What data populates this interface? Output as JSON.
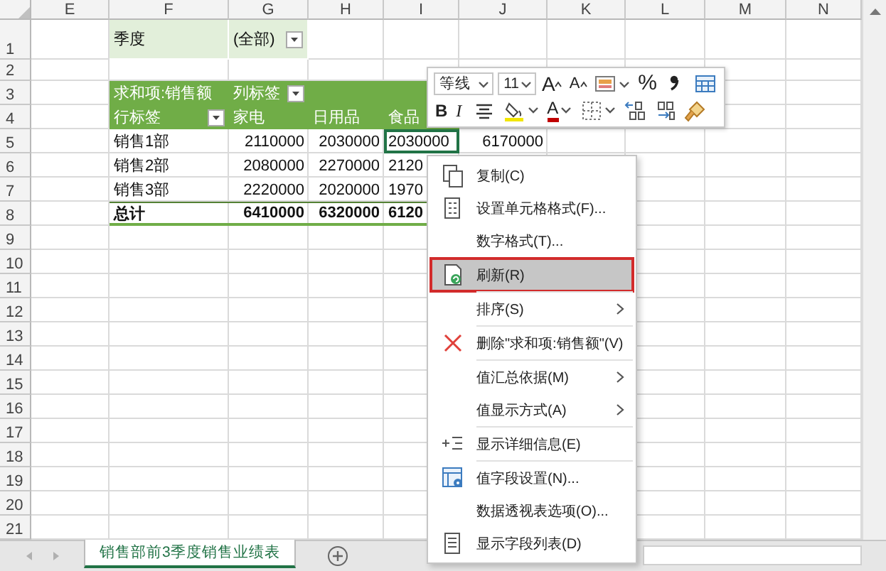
{
  "sheet": {
    "columns": [
      "E",
      "F",
      "G",
      "H",
      "I",
      "J",
      "K",
      "L",
      "M",
      "N"
    ],
    "rows": [
      "1",
      "2",
      "3",
      "4",
      "5",
      "6",
      "7",
      "8",
      "9",
      "10",
      "11",
      "12",
      "13",
      "14",
      "15",
      "16",
      "17",
      "18",
      "19",
      "20",
      "21"
    ]
  },
  "pivot": {
    "filter": {
      "label": "季度",
      "value": "(全部)"
    },
    "value_field": "求和项:销售额",
    "column_label": "列标签",
    "row_label": "行标签",
    "categories": [
      "家电",
      "日用品",
      "食品"
    ],
    "rows": [
      {
        "name": "销售1部",
        "values": [
          {
            "text": "2110000",
            "selected": false
          },
          {
            "text": "2030000",
            "selected": false
          },
          {
            "text": "2030000",
            "selected": true
          },
          {
            "text": "6170000",
            "selected": false
          }
        ]
      },
      {
        "name": "销售2部",
        "values": [
          {
            "text": "2080000",
            "selected": false
          },
          {
            "text": "2270000",
            "selected": false
          },
          {
            "text": "2120",
            "selected": false
          }
        ]
      },
      {
        "name": "销售3部",
        "values": [
          {
            "text": "2220000",
            "selected": false
          },
          {
            "text": "2020000",
            "selected": false
          },
          {
            "text": "1970",
            "selected": false
          }
        ]
      }
    ],
    "total": {
      "name": "总计",
      "values": [
        {
          "text": "6410000",
          "selected": false
        },
        {
          "text": "6320000",
          "selected": false
        },
        {
          "text": "6120",
          "selected": false
        }
      ]
    }
  },
  "mini_toolbar": {
    "font": "等线",
    "size": "11",
    "top_row": [
      {
        "kind": "grow-font",
        "label": "A",
        "dropdown": false
      },
      {
        "kind": "shrink-font",
        "label": "A",
        "dropdown": false
      },
      {
        "kind": "cell-style",
        "dropdown": true
      },
      {
        "kind": "percent",
        "label": "%",
        "dropdown": false
      },
      {
        "kind": "comma",
        "dropdown": false
      },
      {
        "kind": "table-format",
        "dropdown": false
      }
    ],
    "bottom_row": [
      {
        "kind": "bold",
        "label": "B",
        "dropdown": false
      },
      {
        "kind": "italic",
        "label": "I",
        "dropdown": false
      },
      {
        "kind": "align",
        "dropdown": false
      },
      {
        "kind": "fill-color",
        "dropdown": true
      },
      {
        "kind": "font-color",
        "label": "A",
        "dropdown": true
      },
      {
        "kind": "borders",
        "dropdown": true
      },
      {
        "kind": "increase-decimal",
        "dropdown": false
      },
      {
        "kind": "decrease-decimal",
        "dropdown": false
      },
      {
        "kind": "format-painter",
        "dropdown": false
      }
    ]
  },
  "context_menu": {
    "groups": [
      [
        {
          "label": "复制(C)",
          "kind": "copy",
          "submenu": false,
          "selected": false
        },
        {
          "label": "设置单元格格式(F)...",
          "kind": "format",
          "submenu": false,
          "selected": false
        },
        {
          "label": "数字格式(T)...",
          "kind": "plain",
          "submenu": false,
          "selected": false
        }
      ],
      [
        {
          "label": "刷新(R)",
          "kind": "refresh",
          "submenu": false,
          "selected": true
        }
      ],
      [
        {
          "label": "排序(S)",
          "kind": "plain",
          "submenu": true,
          "selected": false
        }
      ],
      [
        {
          "label": "删除\"求和项:销售额\"(V)",
          "kind": "delete",
          "submenu": false,
          "selected": false
        }
      ],
      [
        {
          "label": "值汇总依据(M)",
          "kind": "plain",
          "submenu": true,
          "selected": false
        },
        {
          "label": "值显示方式(A)",
          "kind": "plain",
          "submenu": true,
          "selected": false
        }
      ],
      [
        {
          "label": "显示详细信息(E)",
          "kind": "details",
          "submenu": false,
          "selected": false
        }
      ],
      [
        {
          "label": "值字段设置(N)...",
          "kind": "field-settings",
          "submenu": false,
          "selected": false
        },
        {
          "label": "数据透视表选项(O)...",
          "kind": "plain",
          "submenu": false,
          "selected": false
        },
        {
          "label": "显示字段列表(D)",
          "kind": "field-list",
          "submenu": false,
          "selected": false
        }
      ]
    ]
  },
  "sheet_tabs": [
    {
      "label": "销售部前3季度销售业绩表",
      "selected": true
    }
  ]
}
